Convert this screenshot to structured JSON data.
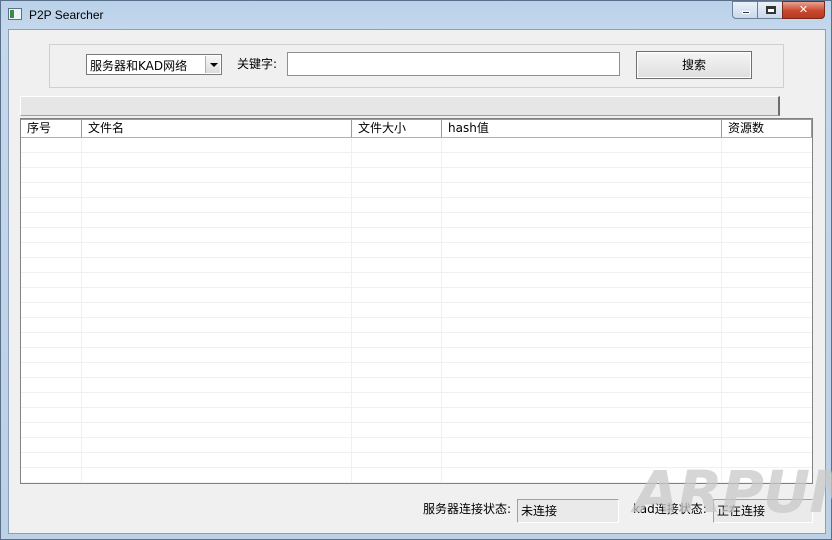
{
  "window": {
    "title": "P2P Searcher",
    "controls": {
      "minimize": "minimize",
      "maximize": "maximize",
      "close": "✕"
    }
  },
  "search": {
    "network_selected": "服务器和KAD网络",
    "keyword_label": "关键字:",
    "keyword_value": "",
    "search_button": "搜索"
  },
  "progress": {
    "percent": 0
  },
  "table": {
    "columns": [
      "序号",
      "文件名",
      "文件大小",
      "hash值",
      "资源数"
    ],
    "rows": []
  },
  "status": {
    "server_label": "服务器连接状态:",
    "server_value": "未连接",
    "kad_label": "kad连接状态:",
    "kad_value": "正在连接"
  },
  "watermark": "ARPUN"
}
